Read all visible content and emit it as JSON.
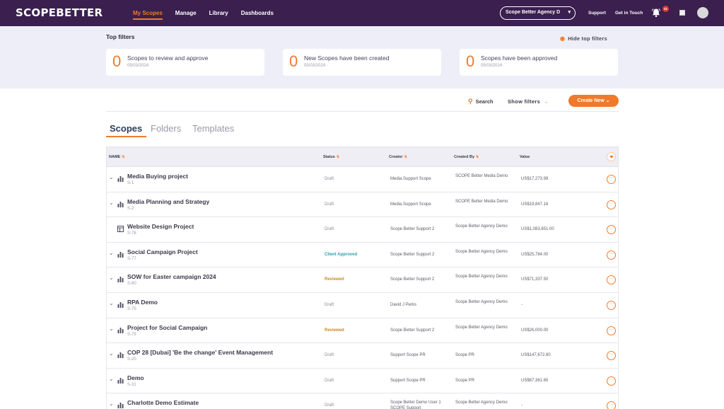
{
  "header": {
    "logo": "SCOPEBETTER",
    "nav": [
      "My Scopes",
      "Manage",
      "Library",
      "Dashboards"
    ],
    "agency_select": "Scope Better Agency D",
    "support": "Support",
    "get_in_touch": "Get in Touch",
    "notifications_count": "21",
    "accent_color": "#f07a2a",
    "bar_color": "#3b1f4f"
  },
  "top_filters": {
    "title": "Top filters",
    "hide_label": "Hide top filters",
    "cards": [
      {
        "count": "0",
        "label": "Scopes to review and approve",
        "date": "05/03/2024"
      },
      {
        "count": "0",
        "label": "New Scopes have been created",
        "date": "05/03/2024"
      },
      {
        "count": "0",
        "label": "Scopes have been approved",
        "date": "05/03/2024"
      }
    ]
  },
  "toolbar": {
    "search": "Search",
    "show_filters": "Show filters",
    "create_new": "Create New"
  },
  "tabs": [
    "Scopes",
    "Folders",
    "Templates"
  ],
  "table": {
    "columns": [
      "NAME",
      "Status",
      "Creator",
      "Created By",
      "Value"
    ],
    "rows": [
      {
        "name": "Media Buying project",
        "code": "S-1",
        "status": "Draft",
        "creator": "Media.Support Scope",
        "created_by": "SCOPE Better Media Demo",
        "value": "US$17,273.99",
        "icon": "bar-chart-icon",
        "expand": true
      },
      {
        "name": "Media Planning and Strategy",
        "code": "S-2",
        "status": "Draft",
        "creator": "Media.Support Scope",
        "created_by": "SCOPE Better Media Demo",
        "value": "US$19,847.16",
        "icon": "bar-chart-icon",
        "expand": true
      },
      {
        "name": "Website Design Project",
        "code": "S-78",
        "status": "Draft",
        "creator": "Scope Better Support 2",
        "created_by": "Scope Better Agency Demo",
        "value": "US$1,083,651.00",
        "icon": "table-icon",
        "expand": false
      },
      {
        "name": "Social Campaign Project",
        "code": "S-77",
        "status": "Client Approved",
        "creator": "Scope Better Support 2",
        "created_by": "Scope Better Agency Demo",
        "value": "US$25,784.00",
        "icon": "bar-chart-icon",
        "expand": true
      },
      {
        "name": "SOW for Easter campaign 2024",
        "code": "S-80",
        "status": "Reviewed",
        "creator": "Scope Better Support 2",
        "created_by": "Scope Better Agency Demo",
        "value": "US$71,337.50",
        "icon": "bar-chart-icon",
        "expand": true
      },
      {
        "name": "RPA Demo",
        "code": "S-75",
        "status": "Draft",
        "creator": "David J Perks",
        "created_by": "Scope Better Agency Demo",
        "value": "-",
        "icon": "bar-chart-icon",
        "expand": true
      },
      {
        "name": "Project for Social Campaign",
        "code": "S-79",
        "status": "Reviewed",
        "creator": "Scope Better Support 2",
        "created_by": "Scope Better Agency Demo",
        "value": "US$26,000.00",
        "icon": "bar-chart-icon",
        "expand": true
      },
      {
        "name": "COP 28 [Dubai] 'Be the change' Event Management",
        "code": "S-20",
        "status": "Draft",
        "creator": "Support Scope PR",
        "created_by": "Scope PR",
        "value": "US$147,672.80",
        "icon": "bar-chart-icon",
        "expand": true
      },
      {
        "name": "Demo",
        "code": "S-31",
        "status": "Draft",
        "creator": "Support Scope PR",
        "created_by": "Scope PR",
        "value": "US$67,361.65",
        "icon": "bar-chart-icon",
        "expand": true
      },
      {
        "name": "Charlotte Demo Estimate",
        "code": "",
        "status": "Draft",
        "creator": "Scope Better Demo User 1 SCOPE Support",
        "created_by": "Scope Better Agency Demo",
        "value": "-",
        "icon": "bar-chart-icon",
        "expand": true
      }
    ]
  }
}
